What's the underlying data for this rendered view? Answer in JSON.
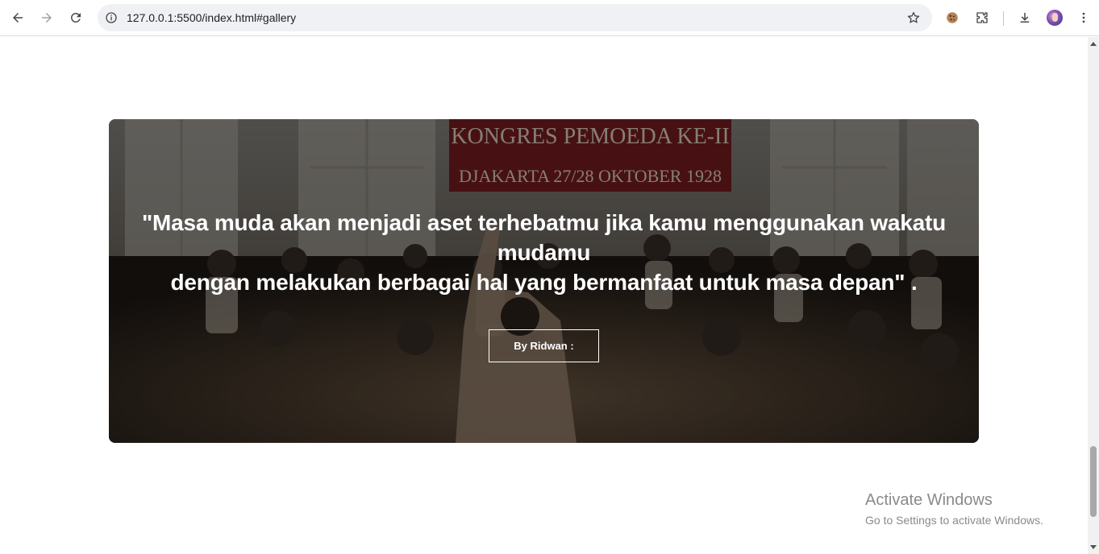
{
  "browser": {
    "url": "127.0.0.1:5500/index.html#gallery"
  },
  "hero": {
    "quote_line1": "\"Masa muda akan menjadi aset terhebatmu jika kamu menggunakan wakatu mudamu",
    "quote_line2": "dengan melakukan berbagai hal yang bermanfaat untuk masa depan\" .",
    "author_button": "By Ridwan :",
    "background_text_1": "KONGRES PEMOEDA KE-II",
    "background_text_2": "DJAKARTA 27/28 OKTOBER 1928"
  },
  "watermark": {
    "title": "Activate Windows",
    "subtitle": "Go to Settings to activate Windows."
  },
  "colors": {
    "overlay": "#000000",
    "quote_text": "#ffffff",
    "banner_red": "#7a1e22"
  }
}
